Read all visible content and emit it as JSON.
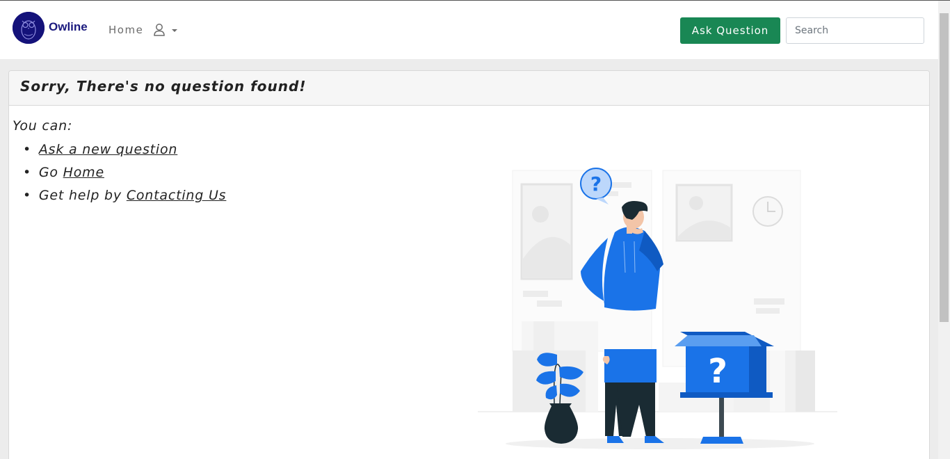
{
  "navbar": {
    "brand": "Owline",
    "home_label": "Home",
    "ask_button_label": "Ask Question",
    "search_placeholder": "Search"
  },
  "message": {
    "title": "Sorry, There's no question found!",
    "intro": "You can:",
    "tips": [
      {
        "prefix": "",
        "link": "Ask a new question"
      },
      {
        "prefix": "Go ",
        "link": "Home"
      },
      {
        "prefix": "Get help by ",
        "link": "Contacting Us"
      }
    ]
  },
  "colors": {
    "brand": "#1b1a7e",
    "ask_button": "#198754",
    "illustration_blue": "#1a73e8"
  },
  "icons": [
    "owl-logo-icon",
    "user-icon",
    "caret-down-icon"
  ]
}
